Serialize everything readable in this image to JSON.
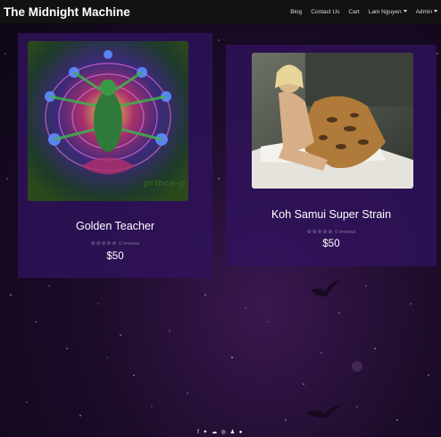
{
  "navbar": {
    "brand": "The Midnight Machine",
    "links": [
      "Blog",
      "Contact Us",
      "Cart"
    ],
    "user_menu": "Lam Nguyen",
    "admin_menu": "Admin"
  },
  "products": [
    {
      "title": "Golden Teacher",
      "rating_stars": "☆☆☆☆☆",
      "reviews": "0 reviews",
      "price": "$50",
      "image_watermark": "prince-p"
    },
    {
      "title": "Koh Samui Super Strain",
      "rating_stars": "☆☆☆☆☆",
      "reviews": "0 reviews",
      "price": "$50"
    }
  ],
  "footer": {
    "social_icons": [
      "facebook-icon",
      "twitter-icon",
      "soundcloud-icon",
      "instagram-icon",
      "snapchat-icon",
      "reddit-icon"
    ]
  },
  "colors": {
    "navbar_bg": "#121212",
    "card_bg": "#30125c",
    "page_bg": "#1c0c2a"
  }
}
